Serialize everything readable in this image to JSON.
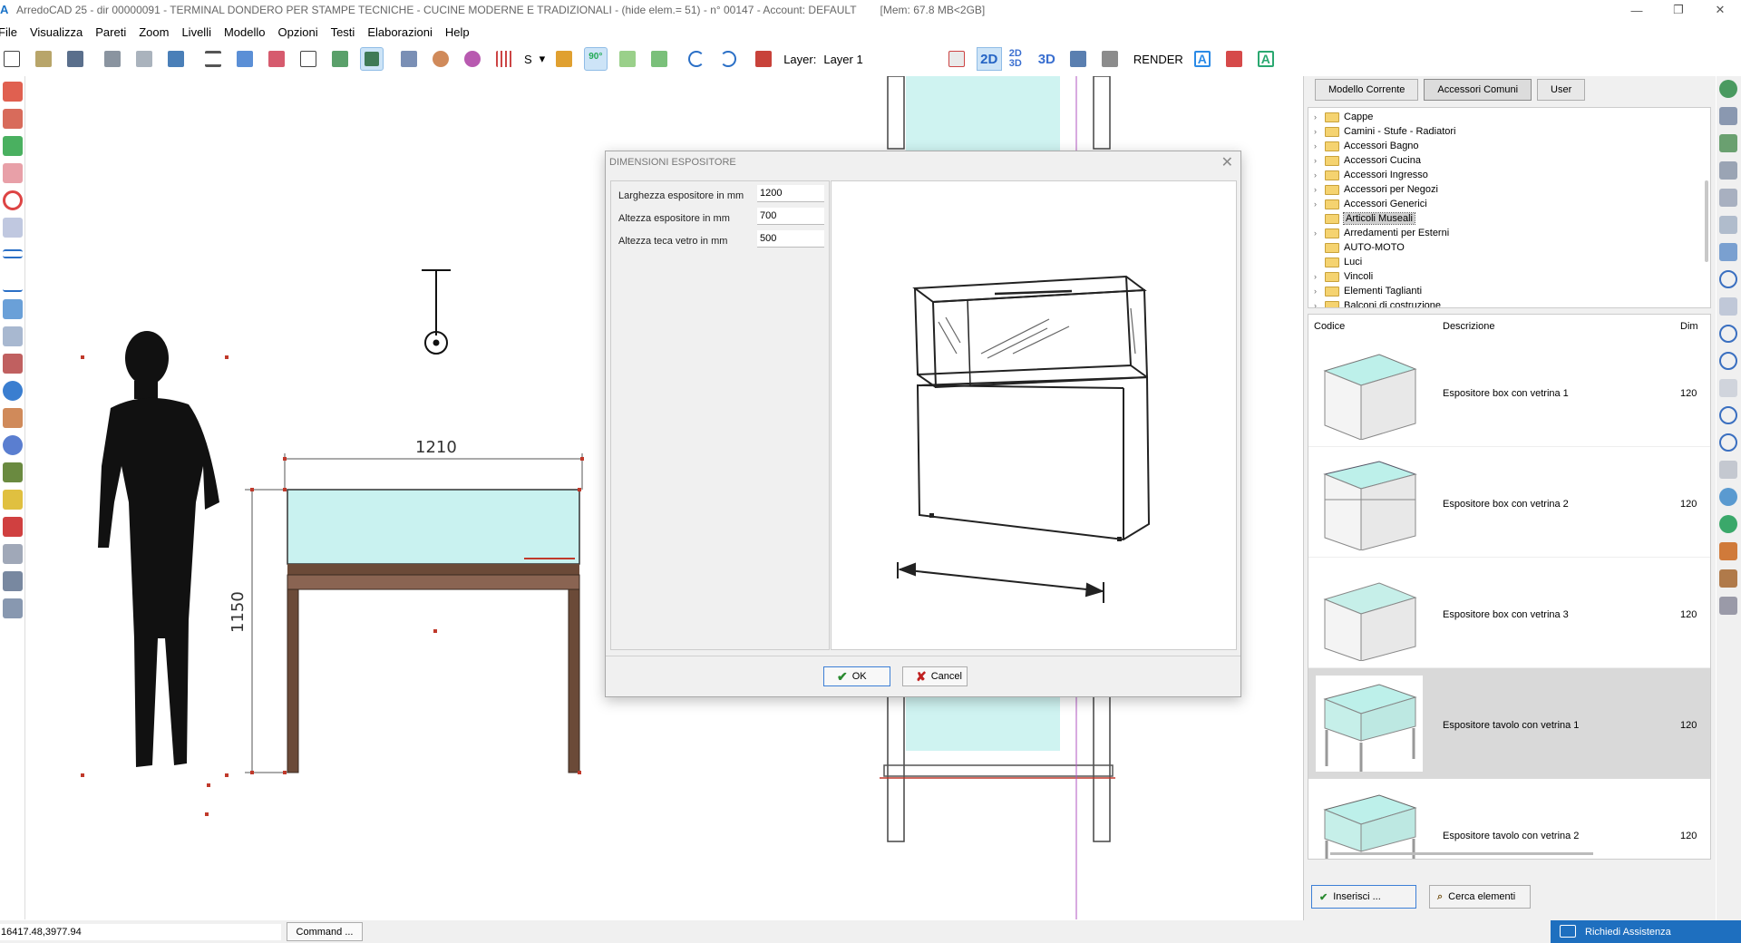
{
  "window": {
    "title": "ArredoCAD 25 - dir 00000091 - TERMINAL DONDERO PER STAMPE TECNICHE - CUCINE MODERNE E TRADIZIONALI - (hide elem.= 51) - n° 00147 - Account: DEFAULT",
    "memory": "[Mem: 67.8 MB<2GB]",
    "app_icon": "A",
    "minimize": "—",
    "maximize": "❐",
    "close": "✕"
  },
  "menu": [
    "File",
    "Visualizza",
    "Pareti",
    "Zoom",
    "Livelli",
    "Modello",
    "Opzioni",
    "Testi",
    "Elaborazioni",
    "Help"
  ],
  "toolbar": {
    "snap_label": "S",
    "rotation_label": "90°",
    "layer_label": "Layer:",
    "layer_value": "Layer 1",
    "view_2d": "2D",
    "view_2d3d": "2D 3D",
    "view_3d": "3D",
    "render_label": "RENDER"
  },
  "drawing": {
    "width_dimension": "1210",
    "height_dimension": "1150"
  },
  "dialog": {
    "title": "DIMENSIONI ESPOSITORE",
    "close": "✕",
    "fields": [
      {
        "label": "Larghezza espositore in mm",
        "value": "1200"
      },
      {
        "label": "Altezza espositore in mm",
        "value": "700"
      },
      {
        "label": "Altezza teca vetro in mm",
        "value": "500"
      }
    ],
    "ok_label": "OK",
    "cancel_label": "Cancel"
  },
  "library": {
    "tabs": [
      "Modello Corrente",
      "Accessori Comuni",
      "User"
    ],
    "active_tab": "Accessori Comuni",
    "tree": [
      {
        "label": "Cappe",
        "expandable": true
      },
      {
        "label": "Camini - Stufe - Radiatori",
        "expandable": true
      },
      {
        "label": "Accessori Bagno",
        "expandable": true
      },
      {
        "label": "Accessori Cucina",
        "expandable": true
      },
      {
        "label": "Accessori Ingresso",
        "expandable": true
      },
      {
        "label": "Accessori per Negozi",
        "expandable": true
      },
      {
        "label": "Accessori Generici",
        "expandable": true
      },
      {
        "label": "Articoli Museali",
        "expandable": false,
        "selected": true
      },
      {
        "label": "Arredamenti per Esterni",
        "expandable": true
      },
      {
        "label": "AUTO-MOTO",
        "expandable": false
      },
      {
        "label": "Luci",
        "expandable": false
      },
      {
        "label": "Vincoli",
        "expandable": true
      },
      {
        "label": "Elementi Taglianti",
        "expandable": true
      },
      {
        "label": "Balconi di costruzione",
        "expandable": true
      }
    ],
    "columns": [
      "Codice",
      "Descrizione",
      "Dim"
    ],
    "items": [
      {
        "description": "Espositore box con vetrina 1",
        "dim": "120",
        "selected": false
      },
      {
        "description": "Espositore box con vetrina 2",
        "dim": "120",
        "selected": false
      },
      {
        "description": "Espositore box con vetrina 3",
        "dim": "120",
        "selected": false
      },
      {
        "description": "Espositore tavolo con vetrina 1",
        "dim": "120",
        "selected": true
      },
      {
        "description": "Espositore tavolo con vetrina 2",
        "dim": "120",
        "selected": false
      }
    ],
    "insert_label": "Inserisci ...",
    "search_label": "Cerca elementi"
  },
  "status": {
    "coordinates": "16417.48,3977.94",
    "command_label": "Command ...",
    "assist_label": "Richiedi Assistenza"
  },
  "colors": {
    "accent": "#1e6fbf",
    "glass": "#c9f2f0",
    "wood": "#6b4a38",
    "selection": "#cde4f7"
  }
}
